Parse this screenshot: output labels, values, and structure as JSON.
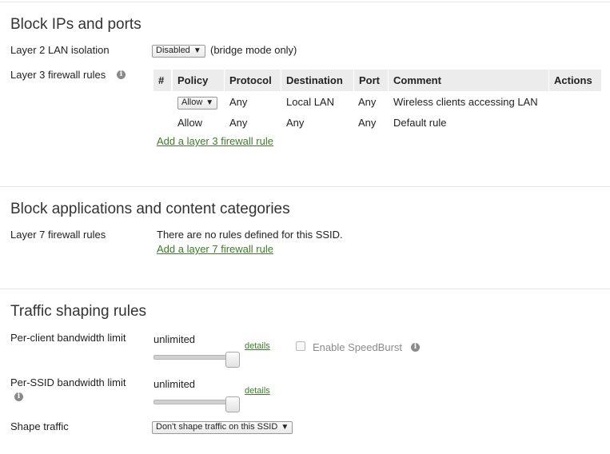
{
  "block_ips": {
    "title": "Block IPs and ports",
    "l2_label": "Layer 2 LAN isolation",
    "l2_select": "Disabled",
    "l2_note": "(bridge mode only)",
    "l3_label": "Layer 3 firewall rules",
    "table": {
      "headers": [
        "#",
        "Policy",
        "Protocol",
        "Destination",
        "Port",
        "Comment",
        "Actions"
      ],
      "rows": [
        {
          "policy": "Allow",
          "protocol": "Any",
          "destination": "Local LAN",
          "port": "Any",
          "comment": "Wireless clients accessing LAN"
        },
        {
          "policy": "Allow",
          "protocol": "Any",
          "destination": "Any",
          "port": "Any",
          "comment": "Default rule"
        }
      ]
    },
    "add_l3_link": "Add a layer 3 firewall rule"
  },
  "block_apps": {
    "title": "Block applications and content categories",
    "l7_label": "Layer 7 firewall rules",
    "no_rules": "There are no rules defined for this SSID.",
    "add_l7_link": "Add a layer 7 firewall rule"
  },
  "traffic": {
    "title": "Traffic shaping rules",
    "per_client_label": "Per-client bandwidth limit",
    "per_client_value": "unlimited",
    "details": "details",
    "speedburst_label": "Enable SpeedBurst",
    "per_ssid_label": "Per-SSID bandwidth limit",
    "per_ssid_value": "unlimited",
    "shape_label": "Shape traffic",
    "shape_select": "Don't shape traffic on this SSID"
  }
}
